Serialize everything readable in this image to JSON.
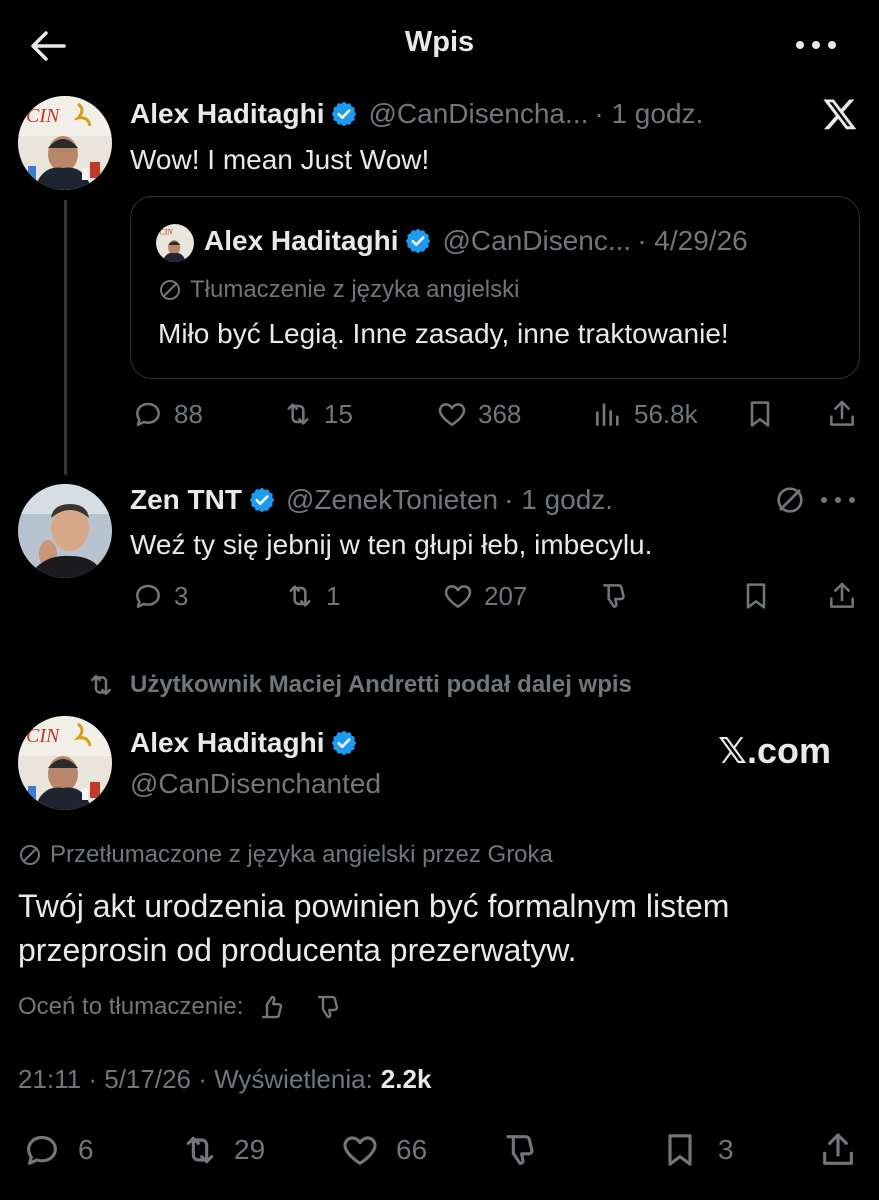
{
  "header": {
    "title": "Wpis"
  },
  "tweet1": {
    "author_name": "Alex Haditaghi",
    "author_handle": "@CanDisencha...",
    "time": "· 1 godz.",
    "text": "Wow! I mean Just Wow!",
    "quote": {
      "author_name": "Alex Haditaghi",
      "author_handle": "@CanDisenc...",
      "date": "· 4/29/26",
      "translation_note": "Tłumaczenie z języka angielski",
      "text": "Miło być Legią. Inne zasady, inne traktowanie!"
    },
    "stats": {
      "replies": "88",
      "reposts": "15",
      "likes": "368",
      "views": "56.8k"
    }
  },
  "tweet2": {
    "author_name": "Zen TNT",
    "author_handle": "@ZenekTonieten",
    "time": "· 1 godz.",
    "text": "Weź ty się jebnij w ten głupi łeb, imbecylu.",
    "stats": {
      "replies": "3",
      "reposts": "1",
      "likes": "207"
    }
  },
  "main_tweet": {
    "repost_note": "Użytkownik Maciej Andretti podał dalej wpis",
    "author_name": "Alex Haditaghi",
    "author_handle": "@CanDisenchanted",
    "watermark": "𝕏.com",
    "translation_note": "Przetłumaczone z języka angielski przez Groka",
    "text": "Twój akt urodzenia powinien być formalnym listem przeprosin od producenta prezerwatyw.",
    "rate_label": "Oceń to tłumaczenie:",
    "timestamp": "21:11 · 5/17/26 · Wyświetlenia:",
    "views": "2.2k",
    "stats": {
      "replies": "6",
      "reposts": "29",
      "likes": "66",
      "bookmarks": "3"
    }
  },
  "colors": {
    "background": "#000000",
    "text": "#e7e9ea",
    "secondary": "#71767b",
    "verified": "#1d9bf0",
    "border": "#2f3336"
  }
}
